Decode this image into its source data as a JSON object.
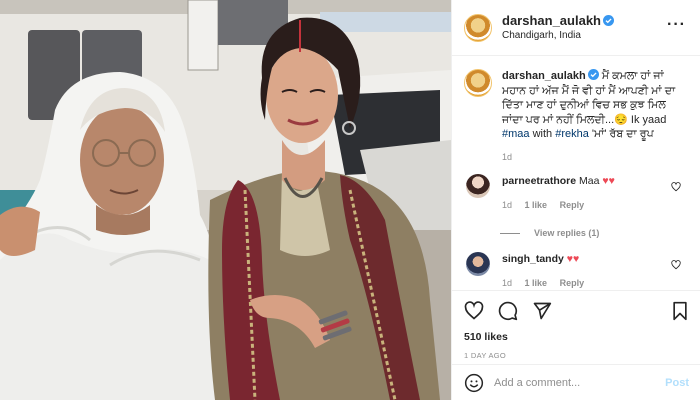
{
  "post": {
    "username": "darshan_aulakh",
    "location": "Chandigarh, India"
  },
  "caption": {
    "username": "darshan_aulakh",
    "text_main": "ਮੈਂ ਕਮਲਾ ਹਾਂ ਜਾਂ ਮਹਾਨ ਹਾਂ ਅੱਜ ਮੈਂ ਜੋ ਵੀ ਹਾਂ ਮੈਂ ਆਪਣੀ ਮਾਂ ਦਾ ਦਿੱਤਾ ਮਾਣ ਹਾਂ ਦੁਨੀਆਂ ਵਿਚ ਸਭ ਕੁਝ ਮਿਲ ਜਾਂਦਾ ਪਰ ਮਾਂ ਨਹੀਂ ਮਿਲਦੀ...",
    "emoji": "😔",
    "text_mid": " Ik yaad ",
    "hashtag_maa": "#maa",
    "text_with": " with ",
    "hashtag_rekha": "#rekha",
    "text_end": " 'ਮਾਂ' ਰੱਬ ਦਾ ਰੂਪ",
    "age": "1d"
  },
  "comments": [
    {
      "username": "parneetrathore",
      "text": " Maa ",
      "hearts": "♥♥",
      "age": "1d",
      "likes": "1 like",
      "reply": "Reply"
    },
    {
      "username": "singh_tandy",
      "text": " ",
      "hearts": "♥♥",
      "age": "1d",
      "likes": "1 like",
      "reply": "Reply"
    }
  ],
  "view_replies": "View replies (1)",
  "likes_count": "510 likes",
  "posted_ago": "1 DAY AGO",
  "add_comment": {
    "placeholder": "Add a comment...",
    "post_label": "Post"
  },
  "colors": {
    "link": "#00376b",
    "verified": "#3897f0",
    "heart": "#ed4956",
    "post_button": "#b2dffc"
  },
  "icons": [
    "heart-icon",
    "comment-icon",
    "share-icon",
    "bookmark-icon",
    "emoji-icon",
    "more-icon",
    "verified-icon"
  ]
}
